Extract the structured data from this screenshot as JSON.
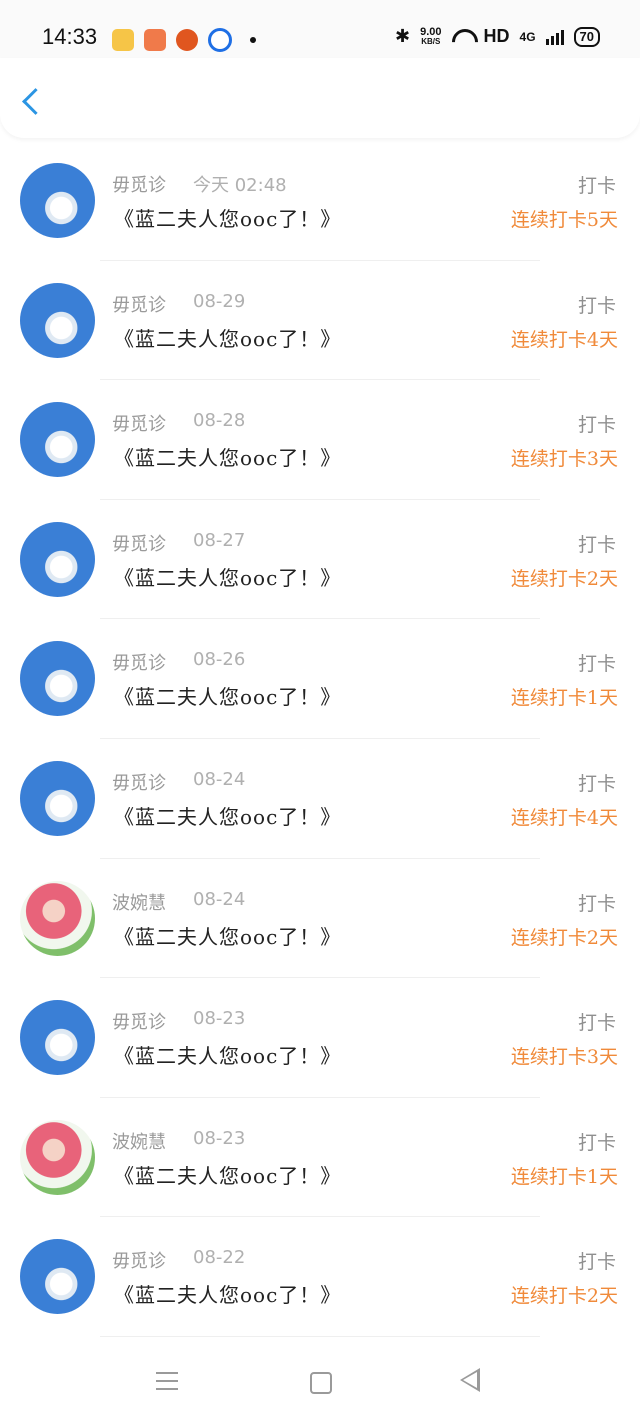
{
  "status": {
    "time": "14:33",
    "speed_value": "9.00",
    "speed_unit": "KB/S",
    "network": "HD",
    "signal": "4G",
    "battery": "70"
  },
  "rows": [
    {
      "user": "毋觅诊",
      "date": "今天 02:48",
      "title": "《蓝二夫人您ooc了！》",
      "kind": "打卡",
      "streak": "连续打卡5天"
    },
    {
      "user": "毋觅诊",
      "date": "08-29",
      "title": "《蓝二夫人您ooc了！》",
      "kind": "打卡",
      "streak": "连续打卡4天"
    },
    {
      "user": "毋觅诊",
      "date": "08-28",
      "title": "《蓝二夫人您ooc了！》",
      "kind": "打卡",
      "streak": "连续打卡3天"
    },
    {
      "user": "毋觅诊",
      "date": "08-27",
      "title": "《蓝二夫人您ooc了！》",
      "kind": "打卡",
      "streak": "连续打卡2天"
    },
    {
      "user": "毋觅诊",
      "date": "08-26",
      "title": "《蓝二夫人您ooc了！》",
      "kind": "打卡",
      "streak": "连续打卡1天"
    },
    {
      "user": "毋觅诊",
      "date": "08-24",
      "title": "《蓝二夫人您ooc了！》",
      "kind": "打卡",
      "streak": "连续打卡4天"
    },
    {
      "user": "波婉慧",
      "date": "08-24",
      "title": "《蓝二夫人您ooc了！》",
      "kind": "打卡",
      "streak": "连续打卡2天"
    },
    {
      "user": "毋觅诊",
      "date": "08-23",
      "title": "《蓝二夫人您ooc了！》",
      "kind": "打卡",
      "streak": "连续打卡3天"
    },
    {
      "user": "波婉慧",
      "date": "08-23",
      "title": "《蓝二夫人您ooc了！》",
      "kind": "打卡",
      "streak": "连续打卡1天"
    },
    {
      "user": "毋觅诊",
      "date": "08-22",
      "title": "《蓝二夫人您ooc了！》",
      "kind": "打卡",
      "streak": "连续打卡2天"
    }
  ],
  "colors": {
    "accent": "#2b95e3",
    "streak": "#f08a3a"
  }
}
